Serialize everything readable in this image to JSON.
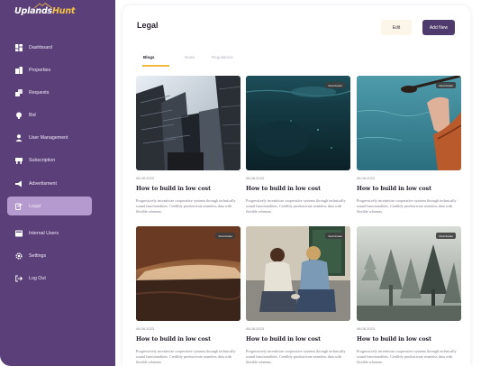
{
  "brand": {
    "name_part1": "Uplands",
    "name_part2": "Hunt",
    "tagline": ""
  },
  "sidebar": {
    "items": [
      {
        "label": "Dashboard",
        "icon": "dashboard-icon"
      },
      {
        "label": "Properties",
        "icon": "properties-icon"
      },
      {
        "label": "Requests",
        "icon": "requests-icon"
      },
      {
        "label": "Bid",
        "icon": "bid-icon"
      },
      {
        "label": "User Management",
        "icon": "users-icon"
      },
      {
        "label": "Subscription",
        "icon": "subscription-icon"
      },
      {
        "label": "Advertisment",
        "icon": "megaphone-icon"
      },
      {
        "label": "Legal",
        "icon": "legal-icon",
        "active": true
      },
      {
        "label": "Internal Users",
        "icon": "internal-users-icon"
      },
      {
        "label": "Settings",
        "icon": "gear-icon"
      },
      {
        "label": "Log Out",
        "icon": "logout-icon"
      }
    ]
  },
  "header": {
    "title": "Legal",
    "edit_label": "Edit",
    "add_label": "Add New"
  },
  "tabs": [
    {
      "label": "Blogs",
      "active": true
    },
    {
      "label": "News"
    },
    {
      "label": "Regulations"
    }
  ],
  "cards": [
    {
      "date": "08.08.2023",
      "title": "How to build in low cost",
      "badge": "",
      "desc": "Progressively incentivize cooperative systems through technically sound functionalities. Credibly productivate seamless data with flexible schemas."
    },
    {
      "date": "08.08.2023",
      "title": "How to build in low cost",
      "badge": "Real Estate",
      "desc": "Progressively incentivize cooperative systems through technically sound functionalities. Credibly productivate seamless data with flexible schemas."
    },
    {
      "date": "08.08.2023",
      "title": "How to build in low cost",
      "badge": "Real Estate",
      "desc": "Progressively incentivize cooperative systems through technically sound functionalities. Credibly productivate seamless data with flexible schemas."
    },
    {
      "date": "08.08.2023",
      "title": "How to build in low cost",
      "badge": "Real Estate",
      "desc": "Progressively incentivize cooperative systems through technically sound functionalities. Credibly productivate seamless data with flexible schemas."
    },
    {
      "date": "08.08.2023",
      "title": "How to build in low cost",
      "badge": "Real Estate",
      "desc": "Progressively incentivize cooperative systems through technically sound functionalities. Credibly productivate seamless data with flexible schemas."
    },
    {
      "date": "08.08.2023",
      "title": "How to build in low cost",
      "badge": "Real Estate",
      "desc": "Progressively incentivize cooperative systems through technically sound functionalities. Credibly productivate seamless data with flexible schemas."
    }
  ],
  "colors": {
    "sidebar": "#5a3f78",
    "active_nav": "#b59ad0",
    "primary_button": "#4e3a6c",
    "tab_accent": "#f0b93c"
  }
}
